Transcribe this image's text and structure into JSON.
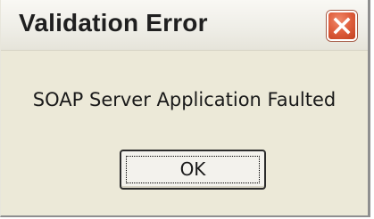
{
  "dialog": {
    "title": "Validation Error",
    "message": "SOAP Server Application Faulted",
    "ok_label": "OK",
    "close_icon": "close-icon"
  },
  "colors": {
    "dialog_background": "#ECE9D8",
    "close_button": "#E0603F"
  }
}
